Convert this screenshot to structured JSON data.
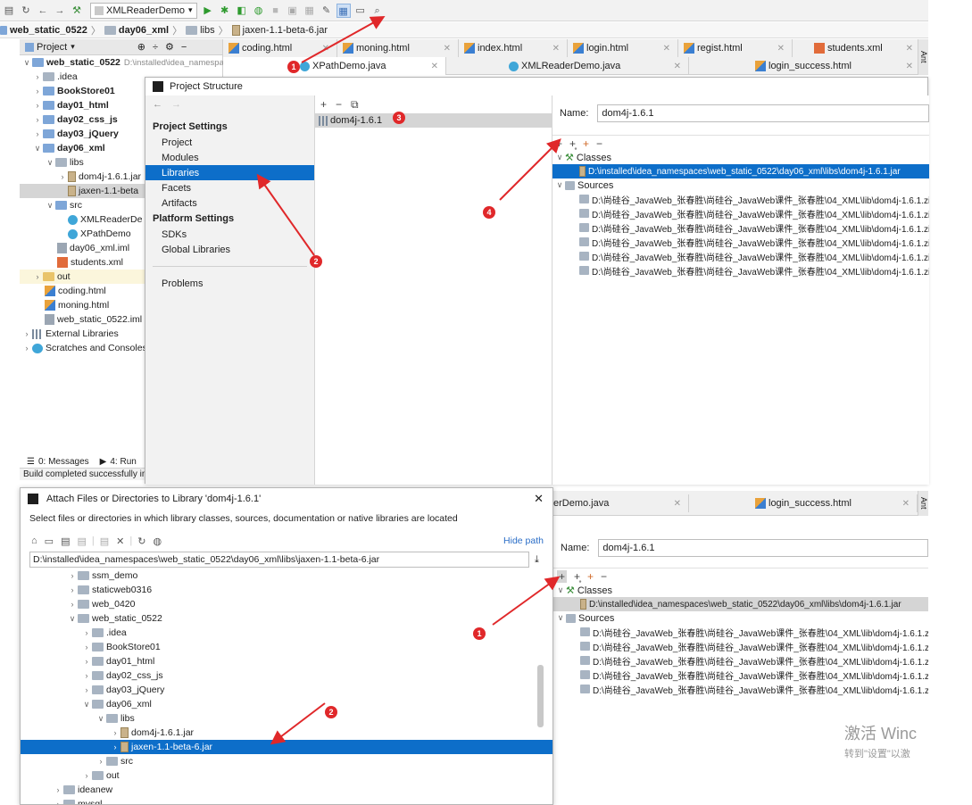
{
  "toolbar": {
    "run_config": "XMLReaderDemo"
  },
  "breadcrumb": [
    "web_static_0522",
    "day06_xml",
    "libs",
    "jaxen-1.1-beta-6.jar"
  ],
  "project_header": "Project",
  "tabs_row1": [
    "coding.html",
    "moning.html",
    "index.html",
    "login.html",
    "regist.html",
    "students.xml"
  ],
  "tabs_row2": [
    "XPathDemo.java",
    "XMLReaderDemo.java",
    "login_success.html"
  ],
  "tree": {
    "root": "web_static_0522",
    "root_path": "D:\\installed\\idea_namespa",
    "items": [
      ".idea",
      "BookStore01",
      "day01_html",
      "day02_css_js",
      "day03_jQuery",
      "day06_xml",
      "libs",
      "dom4j-1.6.1.jar",
      "jaxen-1.1-beta",
      "src",
      "XMLReaderDe",
      "XPathDemo",
      "day06_xml.iml",
      "students.xml",
      "out",
      "coding.html",
      "moning.html",
      "web_static_0522.iml",
      "External Libraries",
      "Scratches and Consoles"
    ]
  },
  "bottom_tabs": [
    "0: Messages",
    "4: Run"
  ],
  "status_text": "Build completed successfully in",
  "project_structure": {
    "title": "Project Structure",
    "project_settings": "Project Settings",
    "ps_items": [
      "Project",
      "Modules",
      "Libraries",
      "Facets",
      "Artifacts"
    ],
    "platform_settings": "Platform Settings",
    "pl_items": [
      "SDKs",
      "Global Libraries"
    ],
    "problems": "Problems",
    "library_name": "dom4j-1.6.1",
    "name_label": "Name:",
    "name_value": "dom4j-1.6.1",
    "classes_label": "Classes",
    "class_path": "D:\\installed\\idea_namespaces\\web_static_0522\\day06_xml\\libs\\dom4j-1.6.1.jar",
    "sources_label": "Sources",
    "sources": [
      "D:\\尚硅谷_JavaWeb_张春胜\\尚硅谷_JavaWeb课件_张春胜\\04_XML\\lib\\dom4j-1.6.1.zip!\\d",
      "D:\\尚硅谷_JavaWeb_张春胜\\尚硅谷_JavaWeb课件_张春胜\\04_XML\\lib\\dom4j-1.6.1.zip!\\d",
      "D:\\尚硅谷_JavaWeb_张春胜\\尚硅谷_JavaWeb课件_张春胜\\04_XML\\lib\\dom4j-1.6.1.zip!\\d",
      "D:\\尚硅谷_JavaWeb_张春胜\\尚硅谷_JavaWeb课件_张春胜\\04_XML\\lib\\dom4j-1.6.1.zip!\\d",
      "D:\\尚硅谷_JavaWeb_张春胜\\尚硅谷_JavaWeb课件_张春胜\\04_XML\\lib\\dom4j-1.6.1.zip!\\d",
      "D:\\尚硅谷_JavaWeb_张春胜\\尚硅谷_JavaWeb课件_张春胜\\04_XML\\lib\\dom4j-1.6.1.zip!\\d"
    ],
    "sources_short": [
      "D:\\尚硅谷_JavaWeb_张春胜\\尚硅谷_JavaWeb课件_张春胜\\04_XML\\lib\\dom4j-1.6.1.zip!\\",
      "D:\\尚硅谷_JavaWeb_张春胜\\尚硅谷_JavaWeb课件_张春胜\\04_XML\\lib\\dom4j-1.6.1.zip!\\",
      "D:\\尚硅谷_JavaWeb_张春胜\\尚硅谷_JavaWeb课件_张春胜\\04_XML\\lib\\dom4j-1.6.1.zip!\\",
      "D:\\尚硅谷_JavaWeb_张春胜\\尚硅谷_JavaWeb课件_张春胜\\04_XML\\lib\\dom4j-1.6.1.zip!\\",
      "D:\\尚硅谷_JavaWeb_张春胜\\尚硅谷_JavaWeb课件_张春胜\\04_XML\\lib\\dom4j-1.6.1.zip!\\"
    ]
  },
  "attach_dialog": {
    "title": "Attach Files or Directories to Library 'dom4j-1.6.1'",
    "description": "Select files or directories in which library classes, sources, documentation or native libraries are located",
    "hide_path": "Hide path",
    "path_value": "D:\\installed\\idea_namespaces\\web_static_0522\\day06_xml\\libs\\jaxen-1.1-beta-6.jar",
    "tree": [
      "ssm_demo",
      "staticweb0316",
      "web_0420",
      "web_static_0522",
      ".idea",
      "BookStore01",
      "day01_html",
      "day02_css_js",
      "day03_jQuery",
      "day06_xml",
      "libs",
      "dom4j-1.6.1.jar",
      "jaxen-1.1-beta-6.jar",
      "src",
      "out",
      "ideanew",
      "mysql"
    ]
  },
  "right_side_tabs": [
    "erDemo.java",
    "login_success.html"
  ],
  "ant_label": "Ant",
  "badges": [
    "1",
    "2",
    "3",
    "4"
  ],
  "watermark": {
    "line1": "激活 Winc",
    "line2": "转到\"设置\"以激"
  },
  "colors": {
    "selection": "#0d6ec9",
    "badge_red": "#e0282a",
    "arrow_red": "#e0282a"
  }
}
